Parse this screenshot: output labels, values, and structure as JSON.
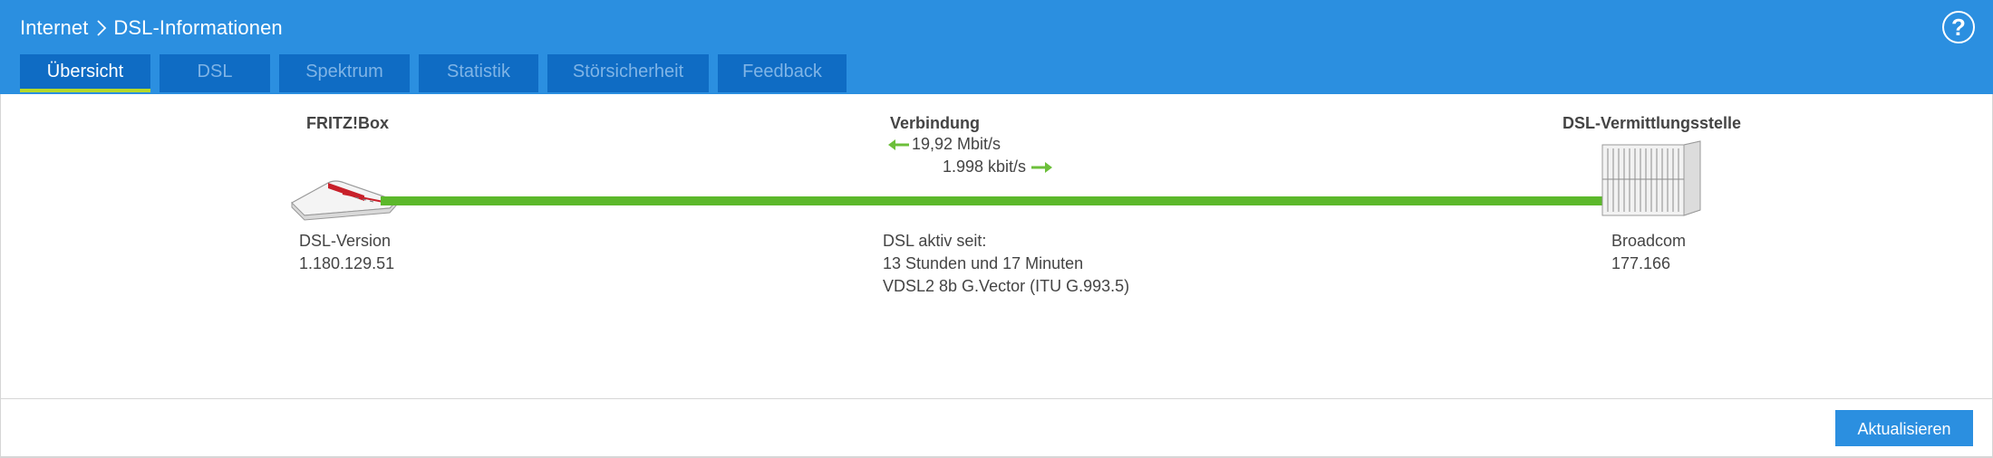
{
  "breadcrumb": {
    "parent": "Internet",
    "current": "DSL-Informationen"
  },
  "help_icon": "help-icon",
  "tabs": [
    {
      "label": "Übersicht",
      "active": true
    },
    {
      "label": "DSL",
      "active": false
    },
    {
      "label": "Spektrum",
      "active": false
    },
    {
      "label": "Statistik",
      "active": false
    },
    {
      "label": "Störsicherheit",
      "active": false
    },
    {
      "label": "Feedback",
      "active": false
    }
  ],
  "fritzbox": {
    "title": "FRITZ!Box",
    "version_label": "DSL-Version",
    "version_value": "1.180.129.51"
  },
  "connection": {
    "title": "Verbindung",
    "downstream": "19,92 Mbit/s",
    "upstream": "1.998 kbit/s",
    "active_label": "DSL aktiv seit:",
    "active_duration": "13 Stunden und 17 Minuten",
    "mode": "VDSL2 8b G.Vector (ITU G.993.5)"
  },
  "exchange": {
    "title": "DSL-Vermittlungsstelle",
    "chipset": "Broadcom",
    "chipset_version": "177.166"
  },
  "footer": {
    "refresh_label": "Aktualisieren"
  },
  "colors": {
    "header": "#2b8fe0",
    "tab": "#0f6cc4",
    "tab_active_underline": "#b6d92a",
    "line": "#5cb82b"
  }
}
